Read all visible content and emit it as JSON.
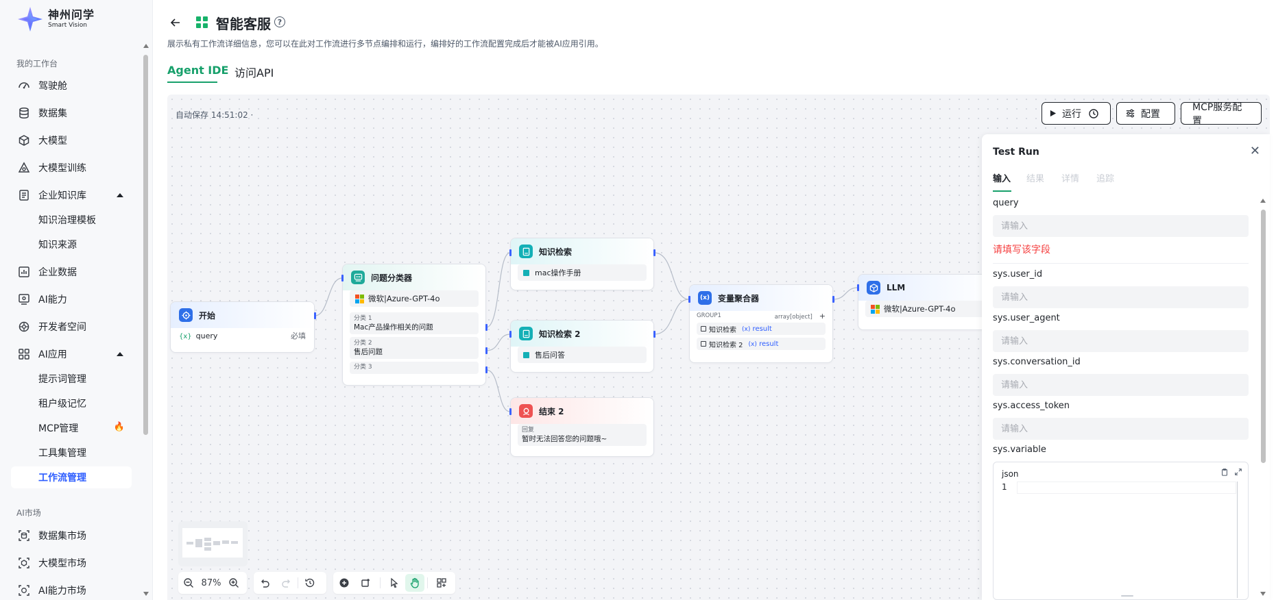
{
  "logo": {
    "name_cn": "神州问学",
    "name_en": "Smart Vision"
  },
  "sidebar": {
    "section_workbench": "我的工作台",
    "items": [
      {
        "label": "驾驶舱",
        "icon": "dashboard-icon"
      },
      {
        "label": "数据集",
        "icon": "database-icon"
      },
      {
        "label": "大模型",
        "icon": "cube-icon"
      },
      {
        "label": "大模型训练",
        "icon": "training-icon"
      },
      {
        "label": "企业知识库",
        "icon": "knowledge-icon"
      },
      {
        "label": "企业数据",
        "icon": "chart-icon"
      },
      {
        "label": "AI能力",
        "icon": "ai-ability-icon"
      },
      {
        "label": "开发者空间",
        "icon": "developer-icon"
      },
      {
        "label": "AI应用",
        "icon": "apps-icon"
      }
    ],
    "knowledge_sub": [
      "知识治理模板",
      "知识来源"
    ],
    "apps_sub": [
      "提示词管理",
      "租户级记忆",
      "MCP管理",
      "工具集管理",
      "工作流管理"
    ],
    "section_market": "AI市场",
    "market_items": [
      {
        "label": "数据集市场",
        "icon": "dataset-market-icon"
      },
      {
        "label": "大模型市场",
        "icon": "model-market-icon"
      },
      {
        "label": "AI能力市场",
        "icon": "ai-market-icon"
      }
    ]
  },
  "header": {
    "title": "智能客服",
    "description": "展示私有工作流详细信息，您可以在此对工作流进行多节点编排和运行，编排好的工作流配置完成后才能被AI应用引用。",
    "tabs": [
      "Agent IDE",
      "访问API"
    ]
  },
  "canvas": {
    "autosave": "自动保存 14:51:02 ·",
    "toolbar": {
      "run": "运行",
      "config": "配置",
      "mcp": "MCP服务配置"
    },
    "zoom": "87%"
  },
  "nodes": {
    "start": {
      "title": "开始",
      "var_name": "query",
      "required": "必填"
    },
    "classifier": {
      "title": "问题分类器",
      "model": "微软|Azure-GPT-4o",
      "cats": [
        {
          "label": "分类 1",
          "text": "Mac产品操作相关的问题"
        },
        {
          "label": "分类 2",
          "text": "售后问题"
        },
        {
          "label": "分类 3",
          "text": ""
        }
      ]
    },
    "kb1": {
      "title": "知识检索",
      "item": "mac操作手册"
    },
    "kb2": {
      "title": "知识检索 2",
      "item": "售后问答"
    },
    "end2": {
      "title": "结束 2",
      "reply_label": "回复",
      "reply_text": "暂时无法回答您的问题哦~"
    },
    "aggregator": {
      "title": "变量聚合器",
      "group": "GROUP1",
      "type": "array[object]",
      "add": "+",
      "rows": [
        {
          "source": "知识检索",
          "var": "result"
        },
        {
          "source": "知识检索 2",
          "var": "result"
        }
      ]
    },
    "llm": {
      "title": "LLM",
      "model": "微软|Azure-GPT-4o"
    }
  },
  "test_run": {
    "title": "Test Run",
    "tabs": [
      "输入",
      "结果",
      "详情",
      "追踪"
    ],
    "placeholder": "请输入",
    "error": "请填写该字段",
    "fields": [
      "query",
      "sys.user_id",
      "sys.user_agent",
      "sys.conversation_id",
      "sys.access_token",
      "sys.variable"
    ],
    "json_label": "json",
    "json_line": "1"
  },
  "colors": {
    "accent_green": "#17a06b",
    "link_blue": "#2c5cff",
    "error_red": "#f53f3f"
  }
}
